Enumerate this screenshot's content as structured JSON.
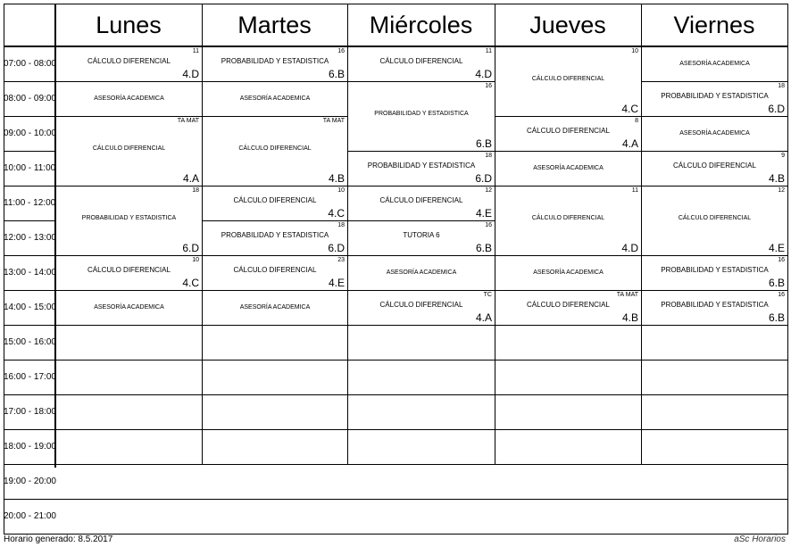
{
  "days": [
    "Lunes",
    "Martes",
    "Miércoles",
    "Jueves",
    "Viernes"
  ],
  "times": [
    "07:00 - 08:00",
    "08:00 - 09:00",
    "09:00 - 10:00",
    "10:00 - 11:00",
    "11:00 - 12:00",
    "12:00 - 13:00",
    "13:00 - 14:00",
    "14:00 - 15:00",
    "15:00 - 16:00",
    "16:00 - 17:00",
    "17:00 - 18:00",
    "18:00 - 19:00",
    "19:00 - 20:00",
    "20:00 - 21:00"
  ],
  "lessons": [
    {
      "day": 0,
      "start": 0,
      "span": 1,
      "subject": "CÁLCULO DIFERENCIAL",
      "room": "11",
      "group": "4.D"
    },
    {
      "day": 0,
      "start": 1,
      "span": 1,
      "subject": "ASESORÍA ACADEMICA",
      "room": "",
      "group": ""
    },
    {
      "day": 0,
      "start": 2,
      "span": 2,
      "subject": "CÁLCULO DIFERENCIAL",
      "room": "TA MAT",
      "group": "4.A"
    },
    {
      "day": 0,
      "start": 4,
      "span": 2,
      "subject": "PROBABILIDAD Y ESTADISTICA",
      "room": "18",
      "group": "6.D"
    },
    {
      "day": 0,
      "start": 6,
      "span": 1,
      "subject": "CÁLCULO DIFERENCIAL",
      "room": "10",
      "group": "4.C"
    },
    {
      "day": 0,
      "start": 7,
      "span": 1,
      "subject": "ASESORÍA ACADEMICA",
      "room": "",
      "group": ""
    },
    {
      "day": 1,
      "start": 0,
      "span": 1,
      "subject": "PROBABILIDAD Y ESTADISTICA",
      "room": "16",
      "group": "6.B"
    },
    {
      "day": 1,
      "start": 1,
      "span": 1,
      "subject": "ASESORÍA ACADEMICA",
      "room": "",
      "group": ""
    },
    {
      "day": 1,
      "start": 2,
      "span": 2,
      "subject": "CÁLCULO DIFERENCIAL",
      "room": "TA MAT",
      "group": "4.B"
    },
    {
      "day": 1,
      "start": 4,
      "span": 1,
      "subject": "CÁLCULO DIFERENCIAL",
      "room": "10",
      "group": "4.C"
    },
    {
      "day": 1,
      "start": 5,
      "span": 1,
      "subject": "PROBABILIDAD Y ESTADISTICA",
      "room": "18",
      "group": "6.D"
    },
    {
      "day": 1,
      "start": 6,
      "span": 1,
      "subject": "CÁLCULO DIFERENCIAL",
      "room": "23",
      "group": "4.E"
    },
    {
      "day": 1,
      "start": 7,
      "span": 1,
      "subject": "ASESORÍA ACADEMICA",
      "room": "",
      "group": ""
    },
    {
      "day": 2,
      "start": 0,
      "span": 1,
      "subject": "CÁLCULO DIFERENCIAL",
      "room": "11",
      "group": "4.D"
    },
    {
      "day": 2,
      "start": 1,
      "span": 2,
      "subject": "PROBABILIDAD Y ESTADISTICA",
      "room": "16",
      "group": "6.B"
    },
    {
      "day": 2,
      "start": 3,
      "span": 1,
      "subject": "PROBABILIDAD Y ESTADISTICA",
      "room": "18",
      "group": "6.D"
    },
    {
      "day": 2,
      "start": 4,
      "span": 1,
      "subject": "CÁLCULO DIFERENCIAL",
      "room": "12",
      "group": "4.E"
    },
    {
      "day": 2,
      "start": 5,
      "span": 1,
      "subject": "TUTORIA 6",
      "room": "16",
      "group": "6.B"
    },
    {
      "day": 2,
      "start": 6,
      "span": 1,
      "subject": "ASESORÍA ACADEMICA",
      "room": "",
      "group": ""
    },
    {
      "day": 2,
      "start": 7,
      "span": 1,
      "subject": "CÁLCULO DIFERENCIAL",
      "room": "TC",
      "group": "4.A"
    },
    {
      "day": 3,
      "start": 0,
      "span": 2,
      "subject": "CÁLCULO DIFERENCIAL",
      "room": "10",
      "group": "4.C"
    },
    {
      "day": 3,
      "start": 2,
      "span": 1,
      "subject": "CÁLCULO DIFERENCIAL",
      "room": "8",
      "group": "4.A"
    },
    {
      "day": 3,
      "start": 3,
      "span": 1,
      "subject": "ASESORÍA ACADEMICA",
      "room": "",
      "group": ""
    },
    {
      "day": 3,
      "start": 4,
      "span": 2,
      "subject": "CÁLCULO DIFERENCIAL",
      "room": "11",
      "group": "4.D"
    },
    {
      "day": 3,
      "start": 6,
      "span": 1,
      "subject": "ASESORÍA ACADEMICA",
      "room": "",
      "group": ""
    },
    {
      "day": 3,
      "start": 7,
      "span": 1,
      "subject": "CÁLCULO DIFERENCIAL",
      "room": "TA MAT",
      "group": "4.B"
    },
    {
      "day": 4,
      "start": 0,
      "span": 1,
      "subject": "ASESORÍA ACADEMICA",
      "room": "",
      "group": ""
    },
    {
      "day": 4,
      "start": 1,
      "span": 1,
      "subject": "PROBABILIDAD Y ESTADISTICA",
      "room": "18",
      "group": "6.D"
    },
    {
      "day": 4,
      "start": 2,
      "span": 1,
      "subject": "ASESORÍA ACADEMICA",
      "room": "",
      "group": ""
    },
    {
      "day": 4,
      "start": 3,
      "span": 1,
      "subject": "CÁLCULO DIFERENCIAL",
      "room": "9",
      "group": "4.B"
    },
    {
      "day": 4,
      "start": 4,
      "span": 2,
      "subject": "CÁLCULO DIFERENCIAL",
      "room": "12",
      "group": "4.E"
    },
    {
      "day": 4,
      "start": 6,
      "span": 1,
      "subject": "PROBABILIDAD Y ESTADISTICA",
      "room": "16",
      "group": "6.B"
    },
    {
      "day": 4,
      "start": 7,
      "span": 1,
      "subject": "PROBABILIDAD Y ESTADISTICA",
      "room": "16",
      "group": "6.B"
    }
  ],
  "footer": {
    "generated": "Horario generado: 8.5.2017",
    "brand": "aSc Horarios"
  }
}
